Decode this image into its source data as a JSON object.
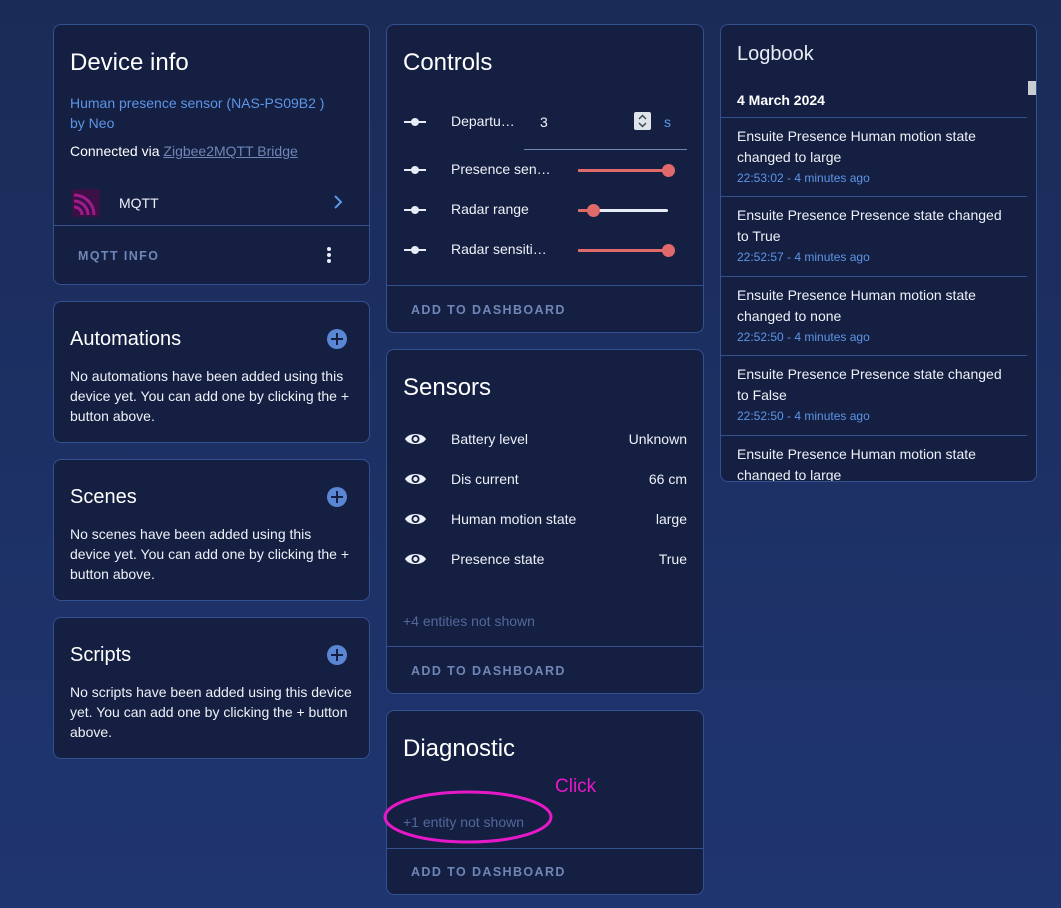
{
  "device_info": {
    "title": "Device info",
    "model": "Human presence sensor (NAS-PS09B2 )",
    "by": "by Neo",
    "connected_prefix": "Connected via ",
    "connected_link": "Zigbee2MQTT Bridge",
    "integration": "MQTT",
    "footer": "MQTT INFO"
  },
  "automations": {
    "title": "Automations",
    "text": "No automations have been added using this device yet. You can add one by clicking the + button above."
  },
  "scenes": {
    "title": "Scenes",
    "text": "No scenes have been added using this device yet. You can add one by clicking the + button above."
  },
  "scripts": {
    "title": "Scripts",
    "text": "No scripts have been added using this device yet. You can add one by clicking the + button above."
  },
  "controls": {
    "title": "Controls",
    "departure_label": "Departu…",
    "departure_value": "3",
    "departure_unit": "s",
    "sliders": [
      {
        "label": "Presence sen…",
        "value": 1.0
      },
      {
        "label": "Radar range",
        "value": 0.17
      },
      {
        "label": "Radar sensitiv…",
        "value": 1.0
      }
    ],
    "footer": "ADD TO DASHBOARD"
  },
  "sensors": {
    "title": "Sensors",
    "rows": [
      {
        "label": "Battery level",
        "value": "Unknown"
      },
      {
        "label": "Dis current",
        "value": "66 cm"
      },
      {
        "label": "Human motion state",
        "value": "large"
      },
      {
        "label": "Presence state",
        "value": "True"
      }
    ],
    "not_shown": "+4 entities not shown",
    "footer": "ADD TO DASHBOARD"
  },
  "diagnostic": {
    "title": "Diagnostic",
    "not_shown": "+1 entity not shown",
    "footer": "ADD TO DASHBOARD"
  },
  "logbook": {
    "title": "Logbook",
    "date": "4 March 2024",
    "entries": [
      {
        "text": "Ensuite Presence Human motion state changed to large",
        "time": "22:53:02 - 4 minutes ago"
      },
      {
        "text": "Ensuite Presence Presence state changed to True",
        "time": "22:52:57 - 4 minutes ago"
      },
      {
        "text": "Ensuite Presence Human motion state changed to none",
        "time": "22:52:50 - 4 minutes ago"
      },
      {
        "text": "Ensuite Presence Presence state changed to False",
        "time": "22:52:50 - 4 minutes ago"
      },
      {
        "text": "Ensuite Presence Human motion state changed to large",
        "time": ""
      }
    ]
  },
  "annotation": {
    "label": "Click",
    "color": "#e619c8"
  },
  "colors": {
    "card": "#141f42",
    "border": "#33508f",
    "accent": "#5d95e6",
    "slider": "#e06a6a",
    "mqtt_icon": "#8a1d7a"
  }
}
